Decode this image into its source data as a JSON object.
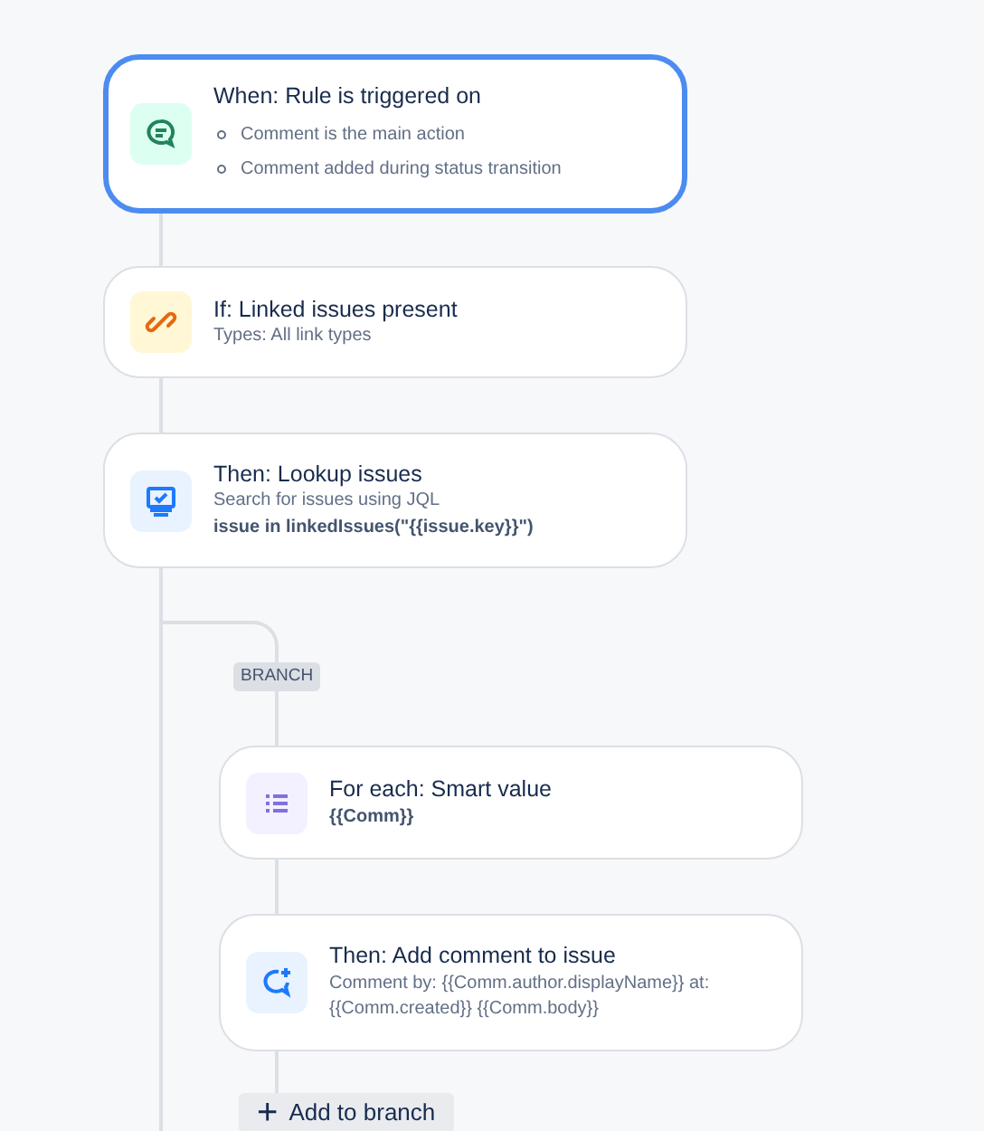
{
  "steps": [
    {
      "kind": "trigger",
      "selected": true,
      "title": "When: Rule is triggered on",
      "bullets": [
        "Comment is the main action",
        "Comment added during status transition"
      ]
    },
    {
      "kind": "condition",
      "selected": false,
      "title": "If: Linked issues present",
      "lines": [
        "Types: All link types"
      ]
    },
    {
      "kind": "lookup",
      "selected": false,
      "title": "Then: Lookup issues",
      "lines": [
        "Search for issues using JQL"
      ],
      "code": "issue in linkedIssues(\"{{issue.key}}\")"
    }
  ],
  "branch": {
    "tag": "BRANCH",
    "steps": [
      {
        "kind": "foreach",
        "selected": false,
        "title": "For each: Smart value",
        "code": "{{Comm}}"
      },
      {
        "kind": "comment",
        "selected": false,
        "title": "Then: Add comment to issue",
        "lines": [
          "Comment by: {{Comm.author.displayName}} at: {{Comm.created}} {{Comm.body}}"
        ]
      }
    ],
    "add_button": {
      "icon": "+",
      "label": "Add to branch"
    }
  }
}
